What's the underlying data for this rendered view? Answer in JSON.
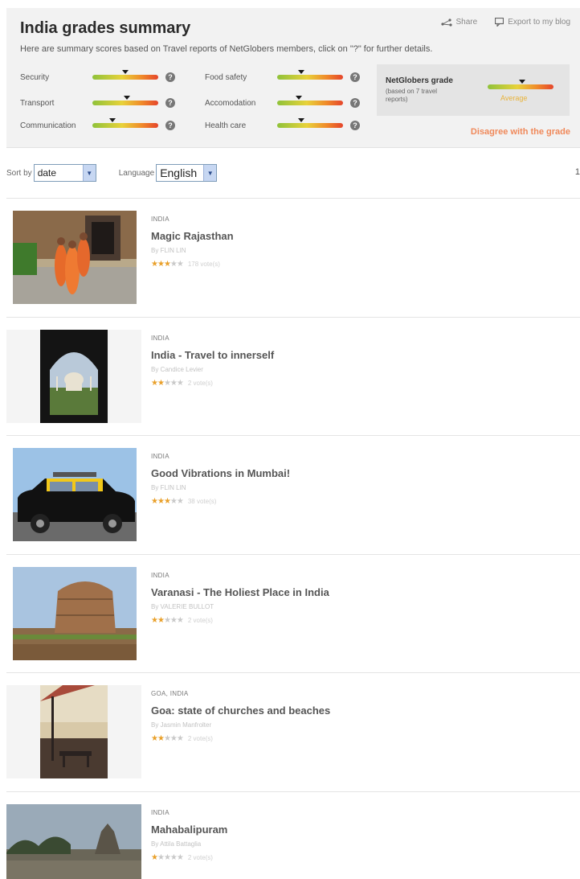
{
  "summary": {
    "title": "India grades summary",
    "description": "Here are summary scores based on Travel reports of NetGlobers members, click on \"?\" for further details.",
    "share_label": "Share",
    "export_label": "Export to my blog",
    "question_mark": "?",
    "grades": [
      {
        "label": "Security",
        "level": 0.5
      },
      {
        "label": "Transport",
        "level": 0.52
      },
      {
        "label": "Communication",
        "level": 0.3
      },
      {
        "label": "Food safety",
        "level": 0.36
      },
      {
        "label": "Accomodation",
        "level": 0.33
      },
      {
        "label": "Health care",
        "level": 0.36
      }
    ],
    "netglobers": {
      "title": "NetGlobers grade",
      "subtitle": "(based on 7 travel reports)",
      "level": 0.52,
      "value": "Average"
    },
    "disagree_label": "Disagree with the grade"
  },
  "sortbar": {
    "sort_label": "Sort by",
    "sort_value": "date",
    "language_label": "Language",
    "language_value": "English",
    "right_glyph": "1"
  },
  "reports": [
    {
      "location": "India",
      "title": "Magic Rajasthan",
      "author": "By FLIN LIN",
      "stars": 2.5,
      "votes": "178 vote(s)"
    },
    {
      "location": "India",
      "title": "India - Travel to innerself",
      "author": "By Candice Levier",
      "stars": 2,
      "votes": "2 vote(s)"
    },
    {
      "location": "India",
      "title": "Good Vibrations in Mumbai!",
      "author": "By FLIN LIN",
      "stars": 3,
      "votes": "38 vote(s)"
    },
    {
      "location": "India",
      "title": "Varanasi - The Holiest Place in India",
      "author": "By VALERIE BULLOT",
      "stars": 2,
      "votes": "2 vote(s)"
    },
    {
      "location": "Goa, India",
      "title": "Goa: state of churches and beaches",
      "author": "By Jasmin Manfrolter",
      "stars": 2,
      "votes": "2 vote(s)"
    },
    {
      "location": "India",
      "title": "Mahabalipuram",
      "author": "By Attila Battaglia",
      "stars": 1,
      "votes": "2 vote(s)"
    }
  ],
  "colors": {
    "accent_orange": "#f0895a",
    "star_on": "#e9a02a",
    "average_text": "#e8b33a"
  }
}
